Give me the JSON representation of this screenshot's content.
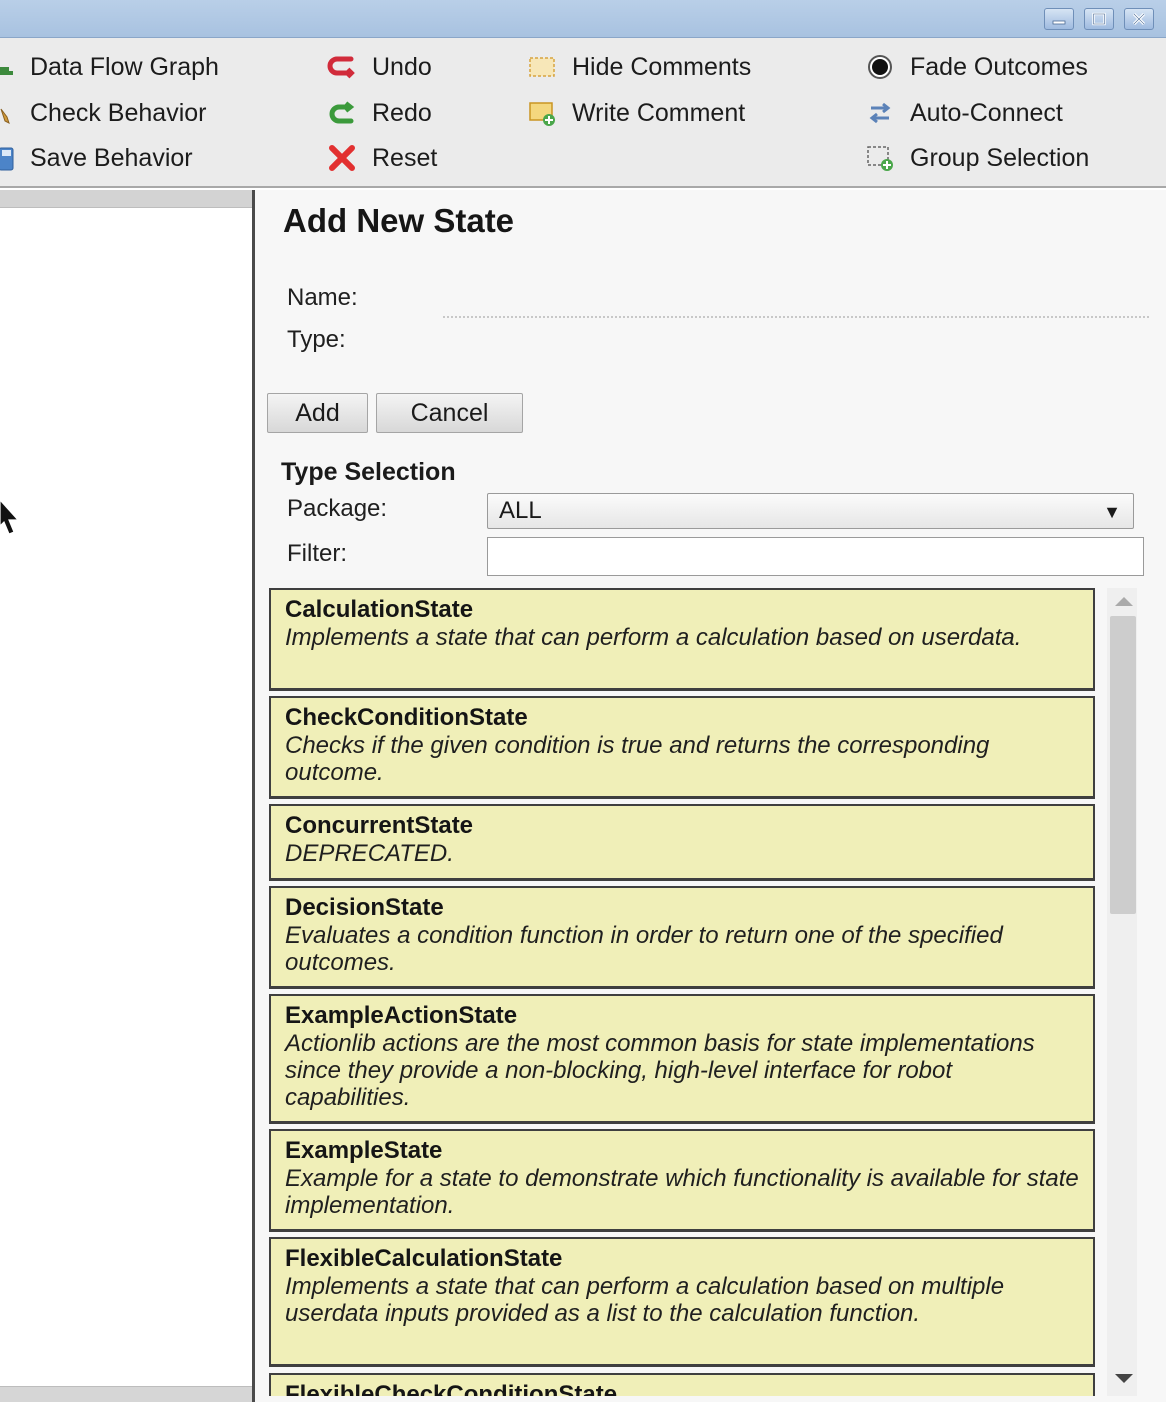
{
  "window": {
    "controls": [
      "minimize",
      "maximize",
      "close"
    ]
  },
  "toolbar": {
    "data_flow_graph": "Data Flow Graph",
    "check_behavior": "Check Behavior",
    "save_behavior": "Save Behavior",
    "undo": "Undo",
    "redo": "Redo",
    "reset": "Reset",
    "hide_comments": "Hide Comments",
    "write_comment": "Write Comment",
    "fade_outcomes": "Fade Outcomes",
    "auto_connect": "Auto-Connect",
    "group_selection": "Group Selection",
    "icons": {
      "undo": "undo-icon",
      "redo": "redo-icon",
      "reset": "reset-icon",
      "hide_comments": "comment-icon",
      "write_comment": "add-comment-icon",
      "fade_outcomes": "radio-icon",
      "auto_connect": "connect-arrows-icon",
      "group_selection": "group-selection-icon"
    }
  },
  "panel": {
    "title": "Add New State",
    "name_label": "Name:",
    "type_label": "Type:",
    "name_value": "",
    "add_button": "Add",
    "cancel_button": "Cancel",
    "type_selection_title": "Type Selection",
    "package_label": "Package:",
    "package_value": "ALL",
    "filter_label": "Filter:",
    "filter_value": ""
  },
  "states": [
    {
      "name": "CalculationState",
      "desc": "Implements a state that can perform a calculation based on userdata."
    },
    {
      "name": "CheckConditionState",
      "desc": "Checks if the given condition is true and returns the corresponding outcome."
    },
    {
      "name": "ConcurrentState",
      "desc": "DEPRECATED."
    },
    {
      "name": "DecisionState",
      "desc": "Evaluates a condition function in order to return one of the specified outcomes."
    },
    {
      "name": "ExampleActionState",
      "desc": "Actionlib actions are the most common basis for state implementations since they provide a non-blocking, high-level interface for robot capabilities."
    },
    {
      "name": "ExampleState",
      "desc": "Example for a state to demonstrate which functionality is available for state implementation."
    },
    {
      "name": "FlexibleCalculationState",
      "desc": "Implements a state that can perform a calculation based on multiple userdata inputs provided as a list to the calculation function."
    },
    {
      "name": "FlexibleCheckConditionState",
      "desc": ""
    }
  ],
  "colors": {
    "card_bg": "#f0efb8",
    "titlebar": "#b9cfe8",
    "toolbar_bg": "#ebebeb"
  }
}
